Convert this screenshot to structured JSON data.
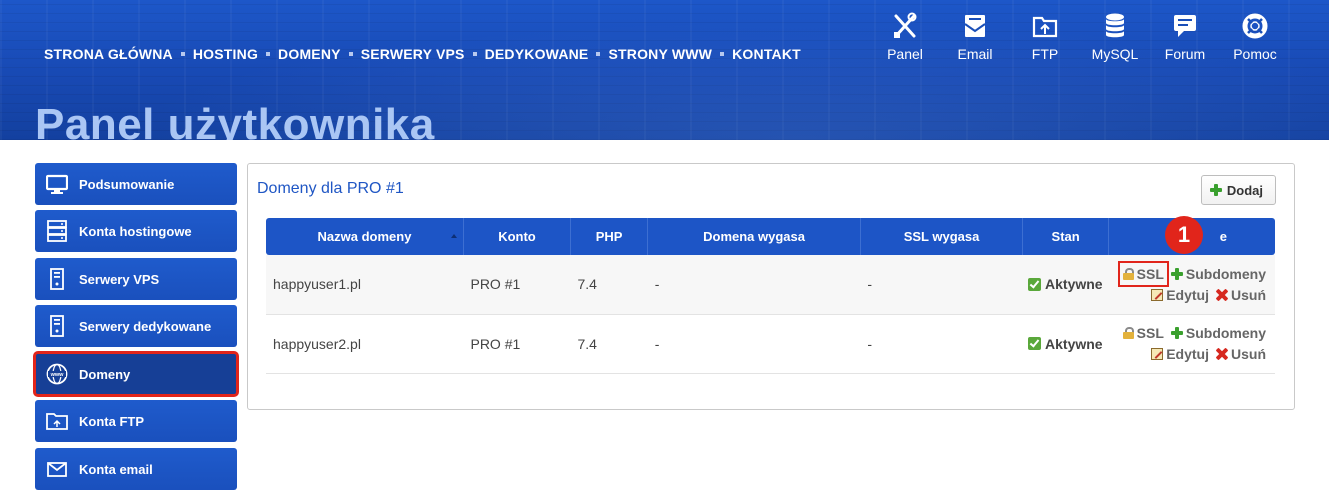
{
  "header": {
    "nav": [
      {
        "label": "STRONA GŁÓWNA"
      },
      {
        "label": "HOSTING"
      },
      {
        "label": "DOMENY"
      },
      {
        "label": "SERWERY VPS"
      },
      {
        "label": "DEDYKOWANE"
      },
      {
        "label": "STRONY WWW"
      },
      {
        "label": "KONTAKT"
      }
    ],
    "tools": [
      {
        "label": "Panel",
        "icon": "tools-icon"
      },
      {
        "label": "Email",
        "icon": "email-icon"
      },
      {
        "label": "FTP",
        "icon": "ftp-folder-icon"
      },
      {
        "label": "MySQL",
        "icon": "database-icon"
      },
      {
        "label": "Forum",
        "icon": "chat-icon"
      },
      {
        "label": "Pomoc",
        "icon": "lifebuoy-icon"
      }
    ],
    "page_title": "Panel użytkownika"
  },
  "sidebar": {
    "items": [
      {
        "label": "Podsumowanie",
        "icon": "monitor-icon",
        "active": false
      },
      {
        "label": "Konta hostingowe",
        "icon": "server-rack-icon",
        "active": false
      },
      {
        "label": "Serwery VPS",
        "icon": "server-tower-icon",
        "active": false
      },
      {
        "label": "Serwery dedykowane",
        "icon": "server-tower-icon",
        "active": false
      },
      {
        "label": "Domeny",
        "icon": "www-globe-icon",
        "active": true
      },
      {
        "label": "Konta FTP",
        "icon": "ftp-folder-icon",
        "active": false
      },
      {
        "label": "Konta email",
        "icon": "envelope-icon",
        "active": false
      }
    ]
  },
  "main": {
    "panel_title": "Domeny dla PRO #1",
    "add_label": "Dodaj",
    "table": {
      "columns": [
        "Nazwa domeny",
        "Konto",
        "PHP",
        "Domena wygasa",
        "SSL wygasa",
        "Stan",
        "Akcje"
      ],
      "actions_header_visible": "e",
      "rows": [
        {
          "domain": "happyuser1.pl",
          "account": "PRO #1",
          "php": "7.4",
          "domain_expires": "-",
          "ssl_expires": "-",
          "status": "Aktywne",
          "actions": {
            "ssl": "SSL",
            "subdomains": "Subdomeny",
            "edit": "Edytuj",
            "delete": "Usuń"
          }
        },
        {
          "domain": "happyuser2.pl",
          "account": "PRO #1",
          "php": "7.4",
          "domain_expires": "-",
          "ssl_expires": "-",
          "status": "Aktywne",
          "actions": {
            "ssl": "SSL",
            "subdomains": "Subdomeny",
            "edit": "Edytuj",
            "delete": "Usuń"
          }
        }
      ]
    }
  },
  "annotation": {
    "step": "1"
  },
  "colors": {
    "brand_blue": "#1d55c6",
    "highlight_red": "#e1251b",
    "success_green": "#5aa83b"
  }
}
